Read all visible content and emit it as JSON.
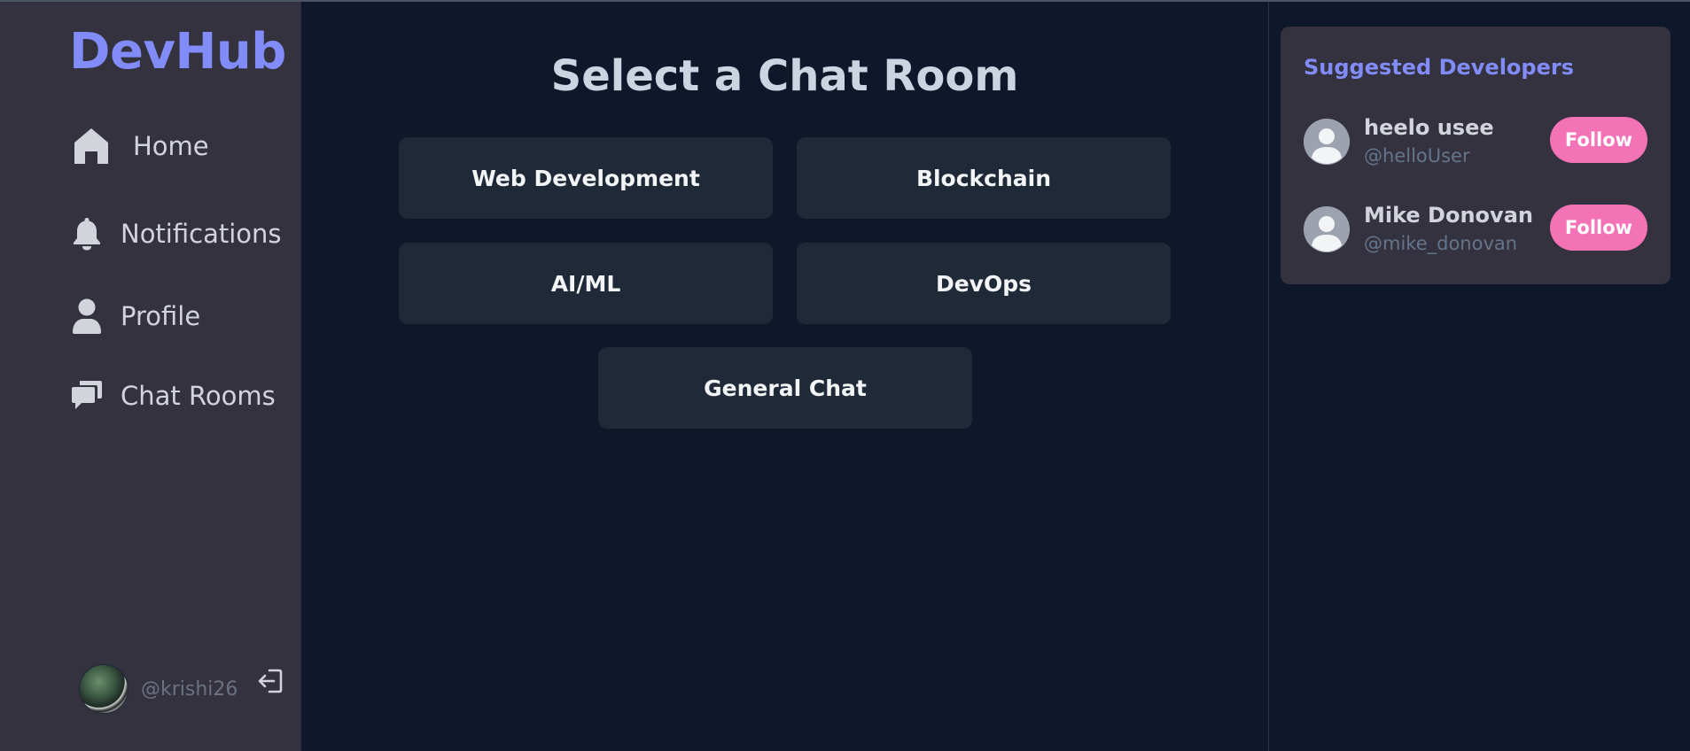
{
  "app": {
    "logo": "DevHub"
  },
  "sidebar": {
    "items": [
      {
        "label": "Home",
        "icon": "home-icon"
      },
      {
        "label": "Notifications",
        "icon": "bell-icon"
      },
      {
        "label": "Profile",
        "icon": "user-icon"
      },
      {
        "label": "Chat Rooms",
        "icon": "chat-icon"
      }
    ],
    "user": {
      "handle": "@krishi26",
      "logout_icon": "logout-icon"
    }
  },
  "main": {
    "title": "Select a Chat Room",
    "rooms": [
      {
        "label": "Web Development"
      },
      {
        "label": "Blockchain"
      },
      {
        "label": "AI/ML"
      },
      {
        "label": "DevOps"
      },
      {
        "label": "General Chat"
      }
    ]
  },
  "suggestions": {
    "title": "Suggested Developers",
    "developers": [
      {
        "name": "heelo usee",
        "handle": "@helloUser",
        "follow_label": "Follow"
      },
      {
        "name": "Mike Donovan",
        "handle": "@mike_donovan",
        "follow_label": "Follow"
      }
    ]
  },
  "colors": {
    "accent": "#818cf8",
    "follow": "#f472b6",
    "sidebar_bg": "#35323f",
    "main_bg": "#0f172a",
    "room_bg": "#1f2937"
  }
}
